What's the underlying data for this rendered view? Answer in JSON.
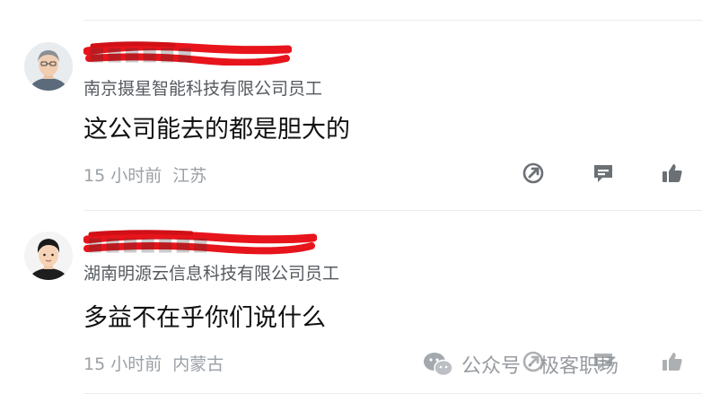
{
  "comments": [
    {
      "company": "南京摄星智能科技有限公司员工",
      "text": "这公司能去的都是胆大的",
      "time": "15 小时前",
      "location": "江苏"
    },
    {
      "company": "湖南明源云信息科技有限公司员工",
      "text": "多益不在乎你们说什么",
      "time": "15 小时前",
      "location": "内蒙古"
    }
  ],
  "watermark": {
    "text": "公众号 · 极客职场"
  },
  "colors": {
    "redaction": "#e8141b",
    "meta": "#9aa0a6",
    "icon": "#6b7075"
  },
  "icons": [
    "share-icon",
    "comment-icon",
    "like-icon",
    "wechat-icon"
  ]
}
